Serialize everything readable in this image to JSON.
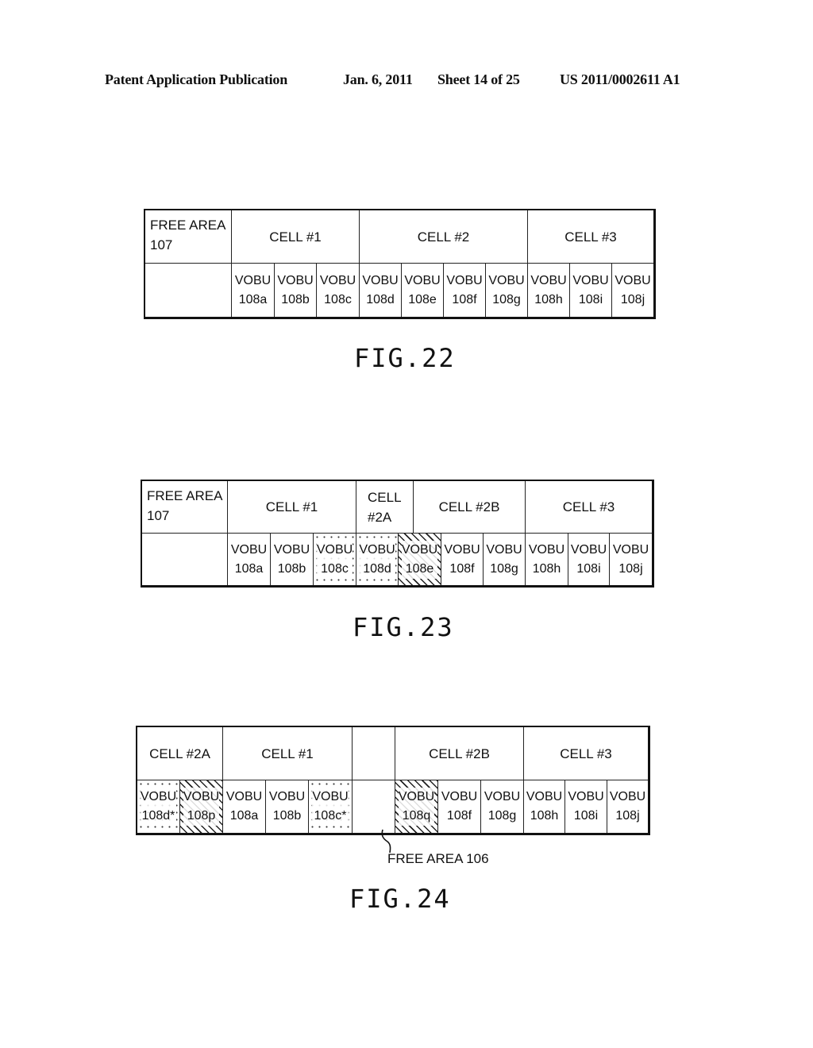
{
  "header": {
    "publication": "Patent Application Publication",
    "date": "Jan. 6, 2011",
    "sheet": "Sheet 14 of 25",
    "number": "US 2011/0002611 A1"
  },
  "fig22": {
    "label": "FIG.22",
    "top_row": [
      "FREE AREA\n107",
      "CELL #1",
      "CELL #2",
      "CELL #3"
    ],
    "vobus": [
      "VOBU\n108a",
      "VOBU\n108b",
      "VOBU\n108c",
      "VOBU\n108d",
      "VOBU\n108e",
      "VOBU\n108f",
      "VOBU\n108g",
      "VOBU\n108h",
      "VOBU\n108i",
      "VOBU\n108j"
    ]
  },
  "fig23": {
    "label": "FIG.23",
    "top_row": [
      "FREE AREA\n107",
      "CELL #1",
      "CELL\n#2A",
      "CELL #2B",
      "CELL #3"
    ],
    "vobus": [
      "VOBU\n108a",
      "VOBU\n108b",
      "VOBU\n108c",
      "VOBU\n108d",
      "VOBU\n108e",
      "VOBU\n108f",
      "VOBU\n108g",
      "VOBU\n108h",
      "VOBU\n108i",
      "VOBU\n108j"
    ],
    "patterns": [
      "none",
      "none",
      "dotted",
      "dotted",
      "hatched",
      "none",
      "none",
      "none",
      "none",
      "none"
    ]
  },
  "fig24": {
    "label": "FIG.24",
    "top_row": [
      "CELL #2A",
      "CELL #1",
      "",
      "CELL #2B",
      "CELL #3"
    ],
    "vobus": [
      "VOBU\n108d*",
      "VOBU\n108p",
      "VOBU\n108a",
      "VOBU\n108b",
      "VOBU\n108c*",
      "",
      "VOBU\n108q",
      "VOBU\n108f",
      "VOBU\n108g",
      "VOBU\n108h",
      "VOBU\n108i",
      "VOBU\n108j"
    ],
    "patterns": [
      "dotted",
      "hatched",
      "none",
      "none",
      "dotted",
      "none",
      "hatched",
      "none",
      "none",
      "none",
      "none",
      "none"
    ],
    "free_area_label": "FREE AREA 106"
  }
}
